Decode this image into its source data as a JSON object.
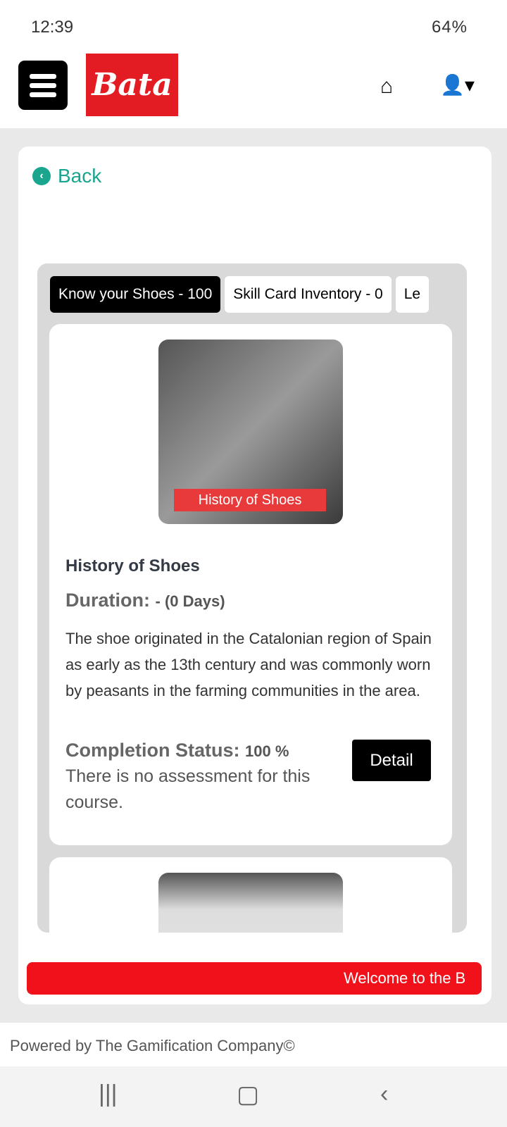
{
  "status_bar": {
    "time": "12:39",
    "battery": "64%"
  },
  "header": {
    "logo": "Bata",
    "home_icon": "home-icon",
    "user_icon": "user-icon"
  },
  "back": {
    "label": "Back"
  },
  "tabs": [
    {
      "label": "Know your Shoes - 100",
      "active": true
    },
    {
      "label": "Skill Card Inventory - 0"
    },
    {
      "label": "Le"
    }
  ],
  "course": {
    "image_label": "History of Shoes",
    "title": "History of Shoes",
    "duration_label": "Duration:",
    "duration_value": "- (0 Days)",
    "description": "The shoe originated in the Catalonian region of Spain as early as the 13th century and was commonly worn by peasants in the farming communities in the area.",
    "completion_label": "Completion Status:",
    "completion_value": "100 %",
    "assessment_note": "There is no assessment for this course.",
    "detail_label": "Detail"
  },
  "marquee": "Welcome to the B",
  "footer": "Powered by The Gamification Company©",
  "colors": {
    "brand": "#e31b23",
    "accent": "#1aa58f",
    "marquee": "#f0111a"
  }
}
